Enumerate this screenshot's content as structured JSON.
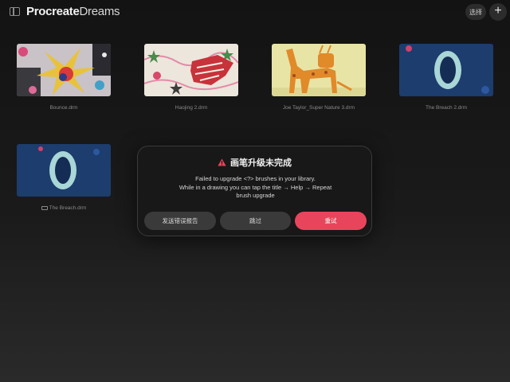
{
  "header": {
    "app_brand": "Procreate",
    "app_product": "Dreams",
    "select_label": "选择",
    "add_label": "+"
  },
  "gallery": {
    "items": [
      {
        "title": "Bounce.drm",
        "artwork": "colorful collage artwork"
      },
      {
        "title": "Haojing 2.drm",
        "artwork": "patterned creature artwork"
      },
      {
        "title": "Joe Taylor_Super Nature 3.drm",
        "artwork": "orange giraffe artwork"
      },
      {
        "title": "The Breach 2.drm",
        "artwork": "blue ring artwork"
      },
      {
        "title": "The Breach.drm",
        "artwork": "blue ring artwork"
      }
    ]
  },
  "dialog": {
    "title": "画笔升级未完成",
    "icon": "warning-icon",
    "message_line1": "Failed to upgrade <?> brushes in your library.",
    "message_line2": "While in a drawing you can tap the title → Help → Repeat",
    "message_line3": "brush upgrade",
    "report_button": "发送错误报告",
    "skip_button": "跳过",
    "retry_button": "重试",
    "colors": {
      "accent": "#e8455c",
      "warning": "#e8455c",
      "button_bg": "#3a3a3a"
    }
  }
}
